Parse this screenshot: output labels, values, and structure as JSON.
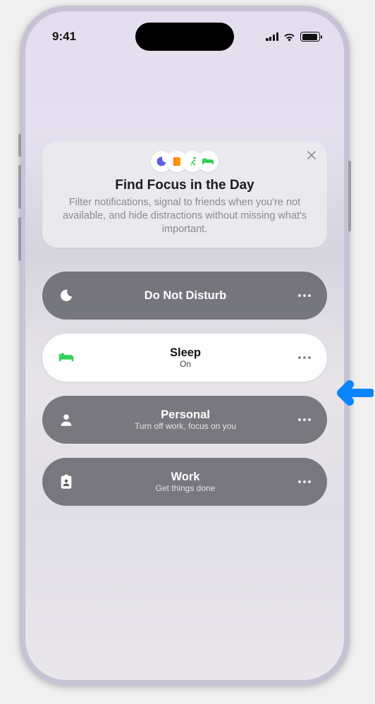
{
  "status": {
    "time": "9:41"
  },
  "card": {
    "title": "Find Focus in the Day",
    "subtitle": "Filter notifications, signal to friends when you're not available, and hide distractions without missing what's important."
  },
  "items": [
    {
      "icon": "moon",
      "label": "Do Not Disturb",
      "sub": "",
      "active": false
    },
    {
      "icon": "bed",
      "label": "Sleep",
      "sub": "On",
      "active": true
    },
    {
      "icon": "person",
      "label": "Personal",
      "sub": "Turn off work, focus on you",
      "active": false
    },
    {
      "icon": "badge",
      "label": "Work",
      "sub": "Get things done",
      "active": false
    }
  ]
}
